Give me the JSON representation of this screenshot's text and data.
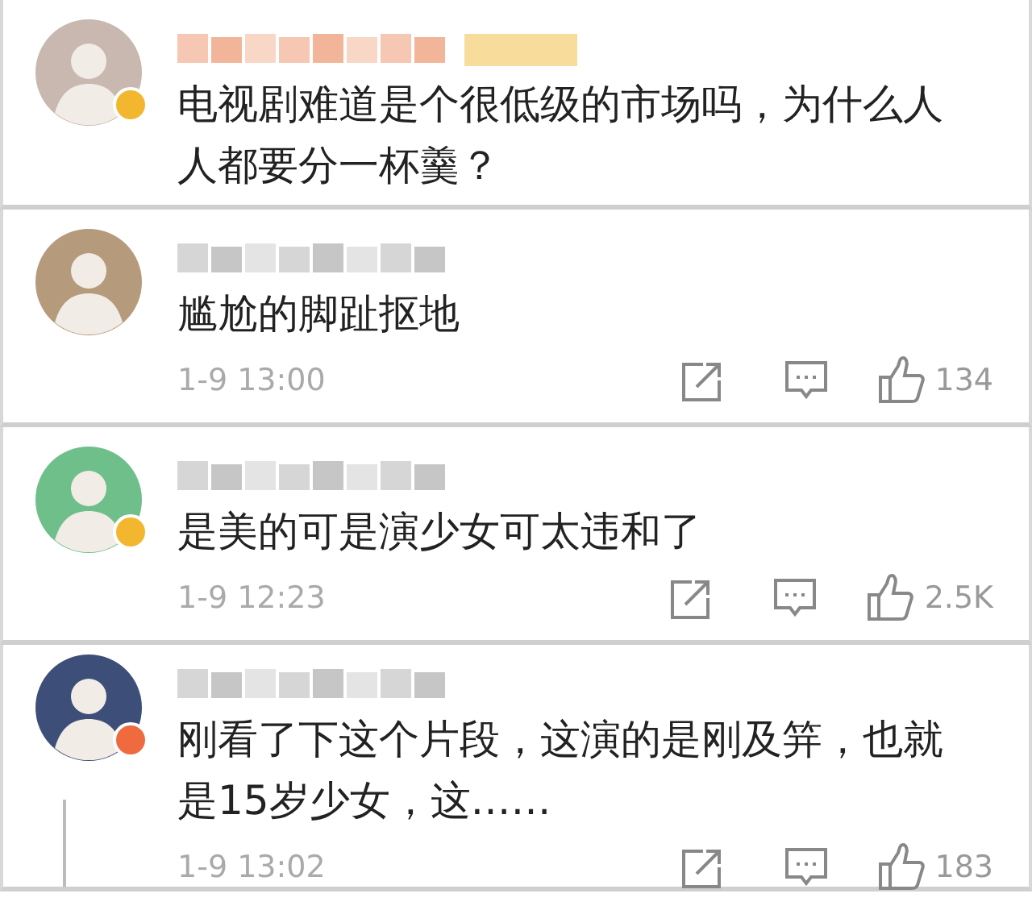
{
  "comments": [
    {
      "vip": true,
      "badge": {
        "color": "#f3b72f"
      },
      "text": "电视剧难道是个很低级的市场吗，为什么人人都要分一杯羹？",
      "thread": false
    },
    {
      "vip": false,
      "text": "尴尬的脚趾抠地",
      "time": "1-9 13:00",
      "likes": "134",
      "thread": false
    },
    {
      "vip": false,
      "badge": {
        "color": "#f3b72f"
      },
      "text": "是美的可是演少女可太违和了",
      "time": "1-9 12:23",
      "likes": "2.5K",
      "thread": false
    },
    {
      "vip": false,
      "badge": {
        "color": "#ef6a3e"
      },
      "text": "刚看了下这个片段，这演的是刚及笄，也就是15岁少女，这……",
      "time": "1-9 13:02",
      "likes": "183",
      "thread": true
    }
  ]
}
